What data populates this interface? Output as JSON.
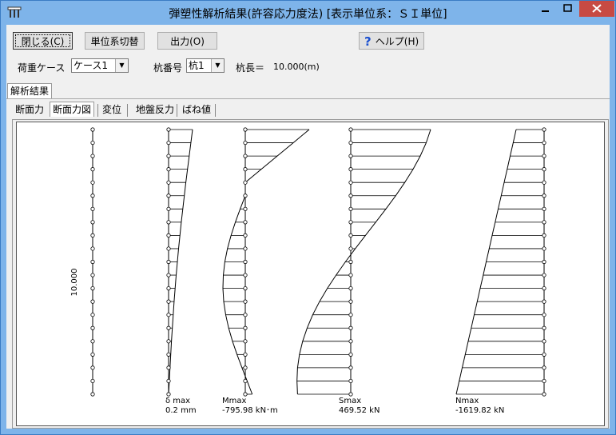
{
  "window": {
    "title": "弾塑性解析結果(許容応力度法) [表示単位系：ＳＩ単位]"
  },
  "toolbar": {
    "close_label": "閉じる(C)",
    "unit_label": "単位系切替",
    "output_label": "出力(O)",
    "help_label": "ヘルプ(H)"
  },
  "controls": {
    "load_case_label": "荷重ケース",
    "load_case_value": "ケース1",
    "pile_no_label": "杭番号",
    "pile_no_value": "杭1",
    "pile_length_label": "杭長＝",
    "pile_length_value": "10.000(m)"
  },
  "tabs_main": [
    "解析結果"
  ],
  "tabs_sub": [
    "断面力",
    "断面力図",
    "変位",
    "地盤反力",
    "ばね値"
  ],
  "diagram": {
    "length_label": "10.000",
    "captions": [
      {
        "name": "δ max",
        "value": "0.2 mm"
      },
      {
        "name": "Mmax",
        "value": "-795.98 kN･m"
      },
      {
        "name": "Smax",
        "value": "469.52 kN"
      },
      {
        "name": "Nmax",
        "value": "-1619.82 kN"
      }
    ]
  }
}
